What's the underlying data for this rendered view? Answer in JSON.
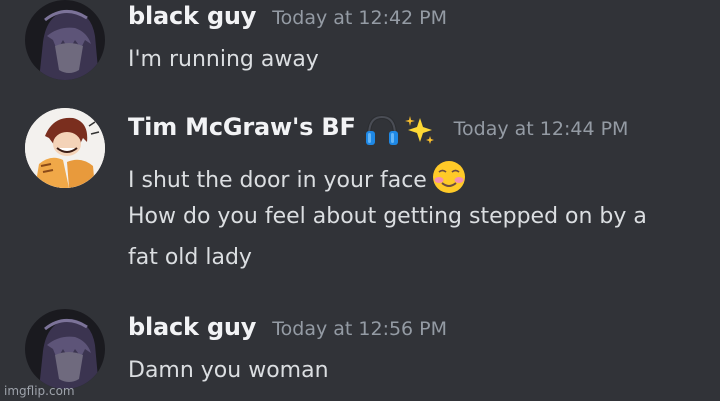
{
  "messages": [
    {
      "author": "black guy",
      "timestamp": "Today at 12:42 PM",
      "lines": [
        "I'm running away"
      ]
    },
    {
      "author": "Tim McGraw's BF",
      "author_badges": [
        "headphones-icon",
        "sparkles-icon"
      ],
      "timestamp": "Today at 12:44 PM",
      "lines": [
        "I shut the door in your face",
        "How do you feel about getting stepped on by a",
        "fat old lady"
      ],
      "line_emoji": "smiling-face-with-blush-emoji"
    },
    {
      "author": "black guy",
      "timestamp": "Today at 12:56 PM",
      "lines": [
        "Damn you woman"
      ]
    }
  ],
  "watermark": "imgflip.com",
  "colors": {
    "background": "#313338",
    "username": "#f2f3f5",
    "timestamp": "#949ba4",
    "message_text": "#dbdee1"
  }
}
